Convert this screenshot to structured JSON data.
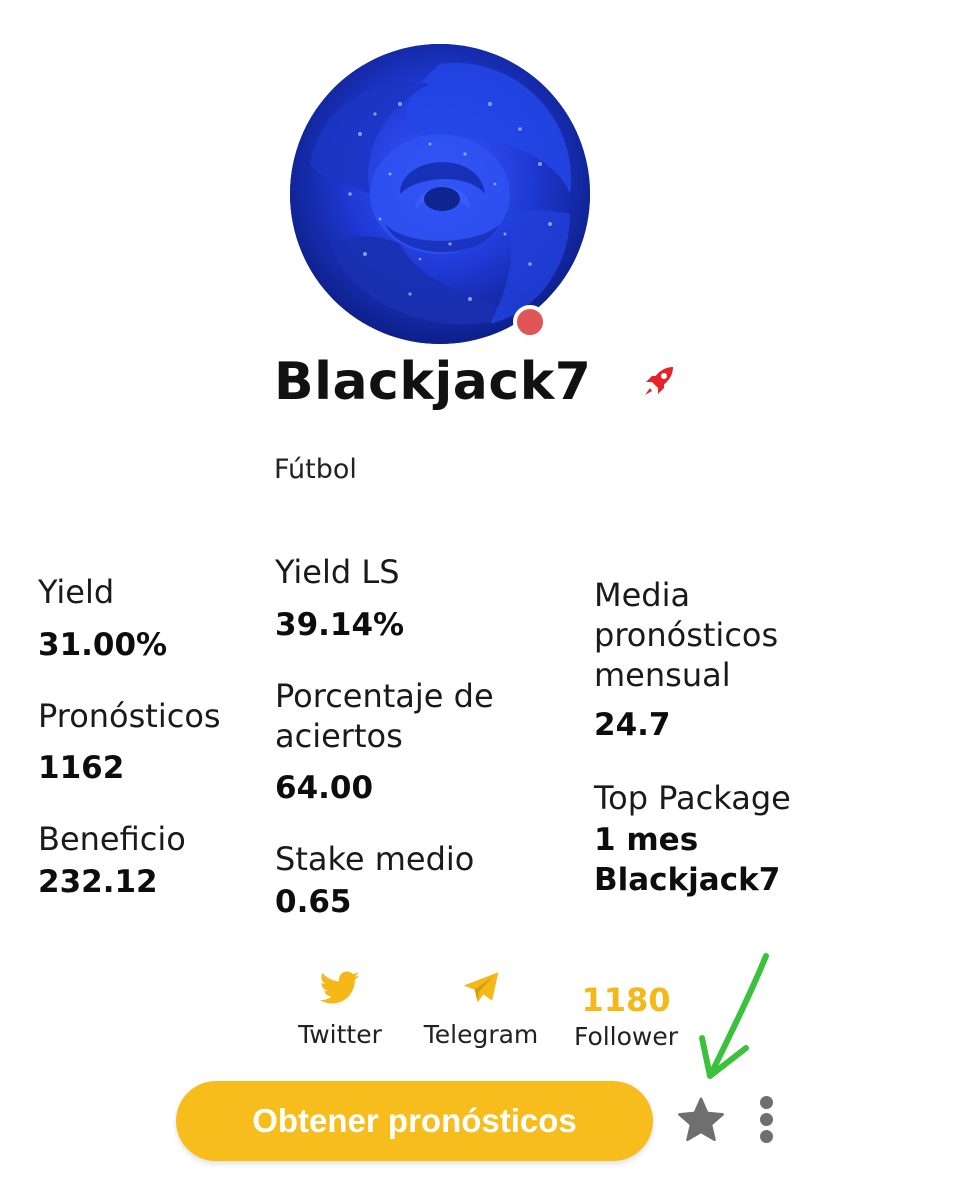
{
  "profile": {
    "username": "Blackjack7",
    "sport": "Fútbol",
    "status_color": "#e05656",
    "badge_icon": "rocket-icon"
  },
  "stats": {
    "yield": {
      "label": "Yield",
      "value": "31.00%"
    },
    "pronosticos": {
      "label": "Pronósticos",
      "value": "1162"
    },
    "beneficio": {
      "label": "Beneficio",
      "value": "232.12"
    },
    "yield_ls": {
      "label": "Yield LS",
      "value": "39.14%"
    },
    "porcentaje": {
      "label_line1": "Porcentaje de",
      "label_line2": "aciertos",
      "value": "64.00"
    },
    "stake": {
      "label": "Stake medio",
      "value": "0.65"
    },
    "media": {
      "label_line1": "Media",
      "label_line2": "pronósticos",
      "label_line3": "mensual",
      "value": "24.7"
    },
    "top_package": {
      "label": "Top Package",
      "value_line1": "1 mes",
      "value_line2": "Blackjack7"
    }
  },
  "social": {
    "twitter": {
      "label": "Twitter",
      "icon": "twitter-bird-icon"
    },
    "telegram": {
      "label": "Telegram",
      "icon": "telegram-plane-icon"
    },
    "followers": {
      "count": "1180",
      "label": "Follower"
    }
  },
  "actions": {
    "cta_label": "Obtener pronósticos",
    "star_icon": "star-icon",
    "more_icon": "more-vertical-icon"
  },
  "colors": {
    "accent": "#f7bd1d",
    "icon_gray": "#6f6f6f",
    "annotation_arrow": "#3cc13c"
  }
}
